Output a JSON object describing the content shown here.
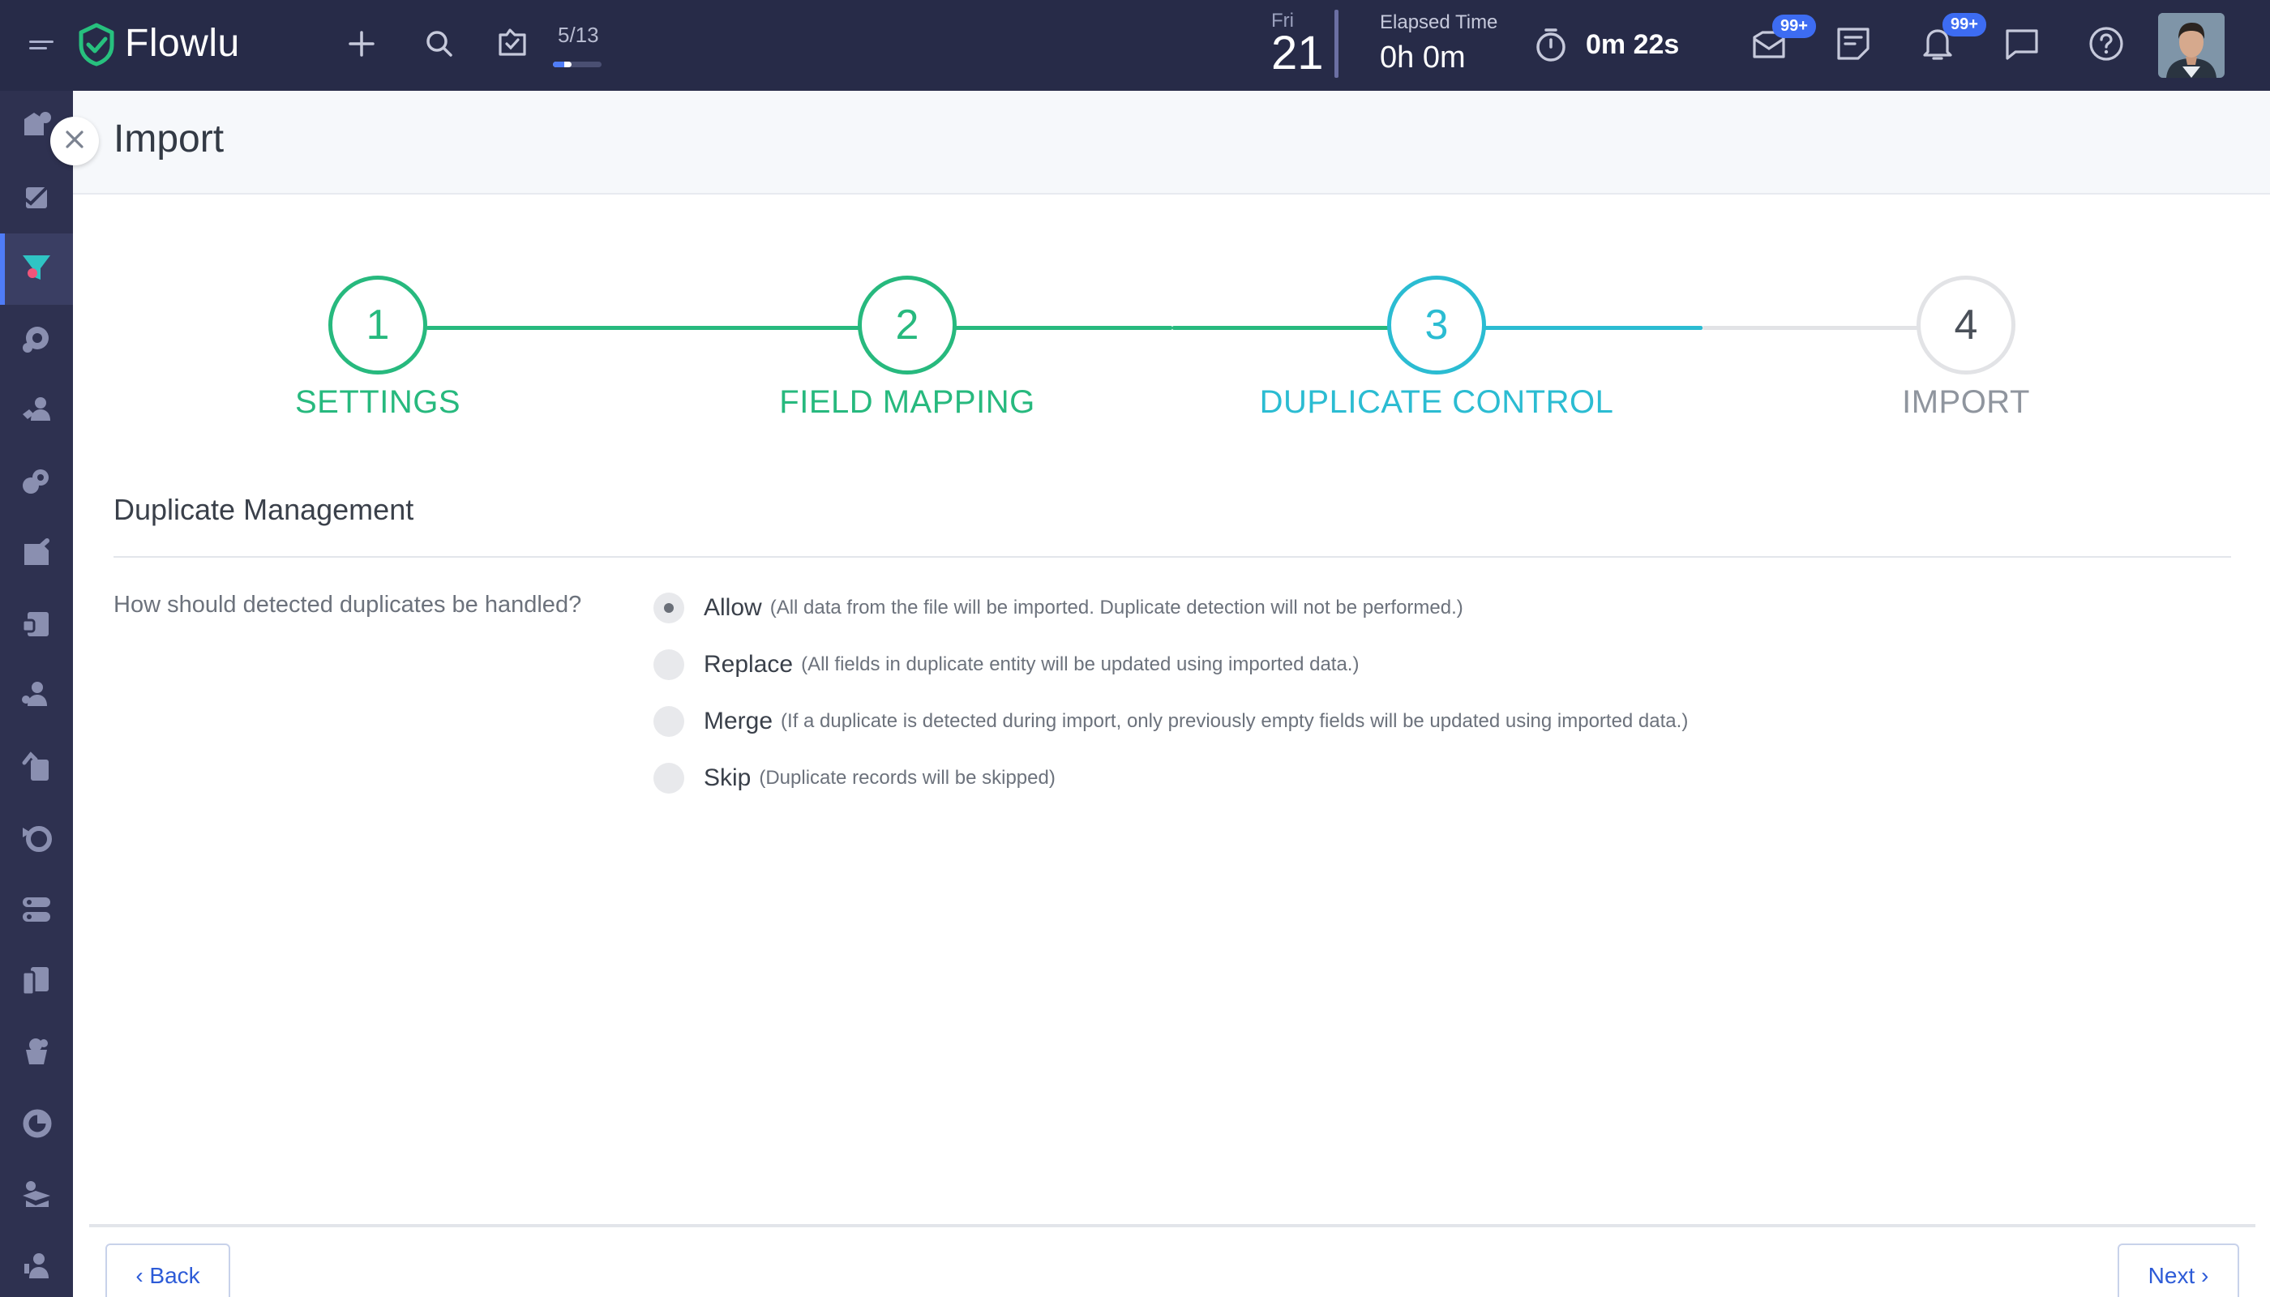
{
  "app": {
    "name": "Flowlu"
  },
  "topbar": {
    "onboarding": {
      "count": "5/13",
      "progress": 0.3846
    },
    "date": {
      "weekday": "Fri",
      "day": "21"
    },
    "elapsed": {
      "label": "Elapsed Time",
      "value": "0h 0m"
    },
    "timer": {
      "value": "0m 22s"
    },
    "mail_badge": "99+",
    "notifications_badge": "99+",
    "icons": [
      "menu-icon",
      "flowlu-logo-icon",
      "plus-icon",
      "search-icon",
      "onboarding-icon",
      "timer-icon",
      "mail-icon",
      "notes-icon",
      "bell-icon",
      "chat-icon",
      "help-icon"
    ]
  },
  "sidebar": {
    "active_index": 2,
    "items": [
      "crm-icon",
      "tasks-icon",
      "funnel-icon",
      "projects-icon",
      "team-icon",
      "finance-icon",
      "invoices-icon",
      "knowledge-icon",
      "contacts-icon",
      "documents-icon",
      "agile-icon",
      "workflow-icon",
      "wiki-icon",
      "sales-icon",
      "reports-icon",
      "learning-icon",
      "settings-icon"
    ]
  },
  "page": {
    "title": "Import"
  },
  "stepper": {
    "steps": [
      {
        "number": "1",
        "label": "SETTINGS",
        "state": "done"
      },
      {
        "number": "2",
        "label": "FIELD MAPPING",
        "state": "done"
      },
      {
        "number": "3",
        "label": "DUPLICATE CONTROL",
        "state": "active"
      },
      {
        "number": "4",
        "label": "IMPORT",
        "state": "pending"
      }
    ],
    "colors": {
      "done": "#27b97e",
      "active": "#2bbcd2",
      "pending": "#e2e3e6",
      "pending_text": "#8f959e"
    }
  },
  "section": {
    "title": "Duplicate Management",
    "question": "How should detected duplicates be handled?",
    "options": [
      {
        "label": "Allow",
        "description": "(All data from the file will be imported. Duplicate detection will not be performed.)",
        "selected": true
      },
      {
        "label": "Replace",
        "description": "(All fields in duplicate entity will be updated using imported data.)",
        "selected": false
      },
      {
        "label": "Merge",
        "description": "(If a duplicate is detected during import, only previously empty fields will be updated using imported data.)",
        "selected": false
      },
      {
        "label": "Skip",
        "description": "(Duplicate records will be skipped)",
        "selected": false
      }
    ]
  },
  "footer": {
    "back_label": "‹ Back",
    "next_label": "Next ›"
  }
}
